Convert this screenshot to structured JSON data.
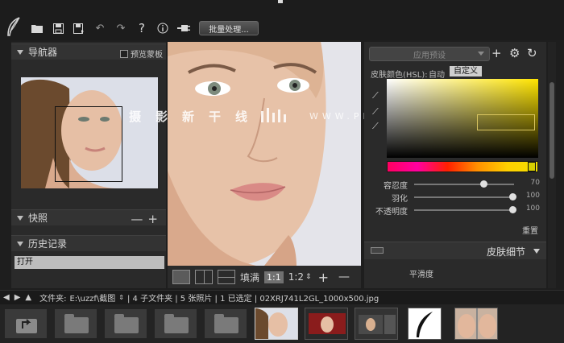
{
  "toolbar": {
    "batch_label": "批量处理...",
    "icons": [
      "feather-logo",
      "folder-open-icon",
      "save-icon",
      "save-as-icon",
      "undo-icon",
      "redo-icon",
      "help-icon",
      "info-icon",
      "plugin-icon"
    ]
  },
  "left_panel": {
    "navigator": {
      "title": "导航器",
      "preview_checkbox": "预览蒙板"
    },
    "snapshots": {
      "title": "快照",
      "minus": "—",
      "plus": "+"
    },
    "history": {
      "title": "历史记录",
      "items": [
        "打开"
      ]
    }
  },
  "center": {
    "watermark_text": "摄影新干线",
    "watermark_url": "WWW.PHOTOSKS.VIP"
  },
  "view_bar": {
    "fill_label": "填满",
    "zoom_1": "1:1",
    "zoom_2": "1:2",
    "plus": "+",
    "minus": "—"
  },
  "right_panel": {
    "preset_placeholder": "应用预设",
    "hsl_label": "皮肤颜色(HSL):",
    "auto_label": "自动",
    "custom_label": "自定义",
    "sliders": [
      {
        "label": "容忍度",
        "value": "70",
        "fraction": 0.7
      },
      {
        "label": "羽化",
        "value": "100",
        "fraction": 1.0
      },
      {
        "label": "不透明度",
        "value": "100",
        "fraction": 1.0
      }
    ],
    "reset_label": "重置",
    "skin_detail_title": "皮肤细节",
    "smoothness_label": "平滑度"
  },
  "path_bar": {
    "folder_label": "文件夹:",
    "path": "E:\\uzzf\\截图",
    "info": "| 4 子文件夹 | 5 张照片 | 1 已选定 | 02XRJ741L2GL_1000x500.jpg"
  },
  "colors": {
    "accent_yellow": "#ffe400",
    "hue_magenta": "#ff0080",
    "panel_bg": "#2a2a2a"
  }
}
